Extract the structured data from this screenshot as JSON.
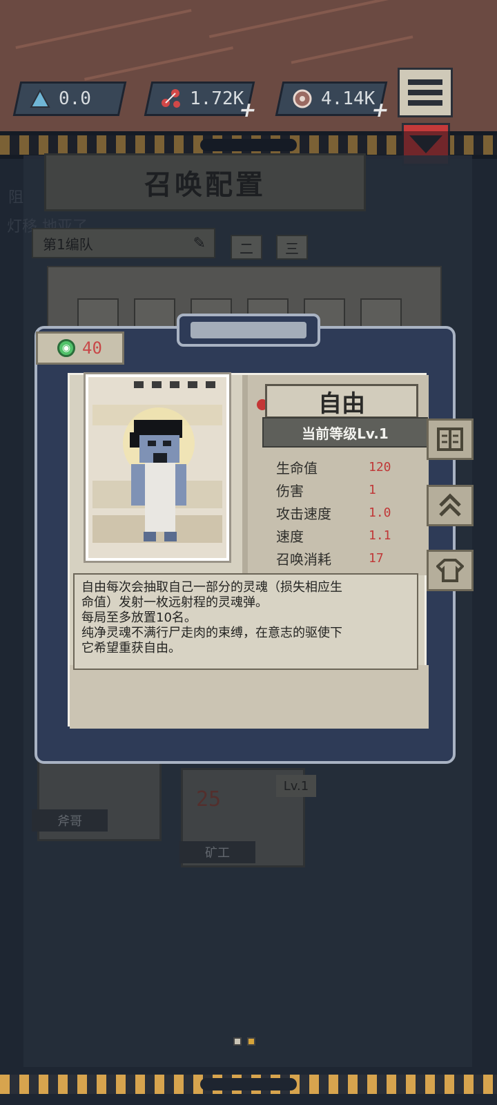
{
  "header": {
    "currencies": [
      {
        "icon": "triangle-icon",
        "value": "0.0",
        "has_plus": false
      },
      {
        "icon": "molecule-icon",
        "value": "1.72K",
        "has_plus": true
      },
      {
        "icon": "soul-orb-icon",
        "value": "4.14K",
        "has_plus": true
      }
    ]
  },
  "panel": {
    "title": "召唤配置",
    "team_select": "第1编队",
    "team_tabs": [
      "二",
      "三"
    ],
    "ghost_lines": [
      "阻",
      "灯移 地亚了"
    ]
  },
  "cards_behind": [
    {
      "name": "斧哥"
    },
    {
      "name": "矿工",
      "level": "Lv.1",
      "cost": "25"
    }
  ],
  "modal": {
    "cost": "40",
    "unit_name": "自由",
    "level_label": "当前等级Lv.1",
    "stats": [
      {
        "label": "生命值",
        "value": "120"
      },
      {
        "label": "伤害",
        "value": "1"
      },
      {
        "label": "攻击速度",
        "value": "1.0"
      },
      {
        "label": "速度",
        "value": "1.1"
      },
      {
        "label": "召唤消耗",
        "value": "17"
      }
    ],
    "description": [
      "自由每次会抽取自己一部分的灵魂（损失相应生",
      "命值）发射一枚远射程的灵魂弹。",
      "每局至多放置10名。",
      "纯净灵魂不满行尸走肉的束缚，在意志的驱使下",
      "它希望重获自由。"
    ]
  },
  "colors": {
    "accent_red": "#c03838",
    "modal_bg": "#2e3b57",
    "paper": "#d6d1c1",
    "hazard_yellow": "#d7a44e"
  }
}
